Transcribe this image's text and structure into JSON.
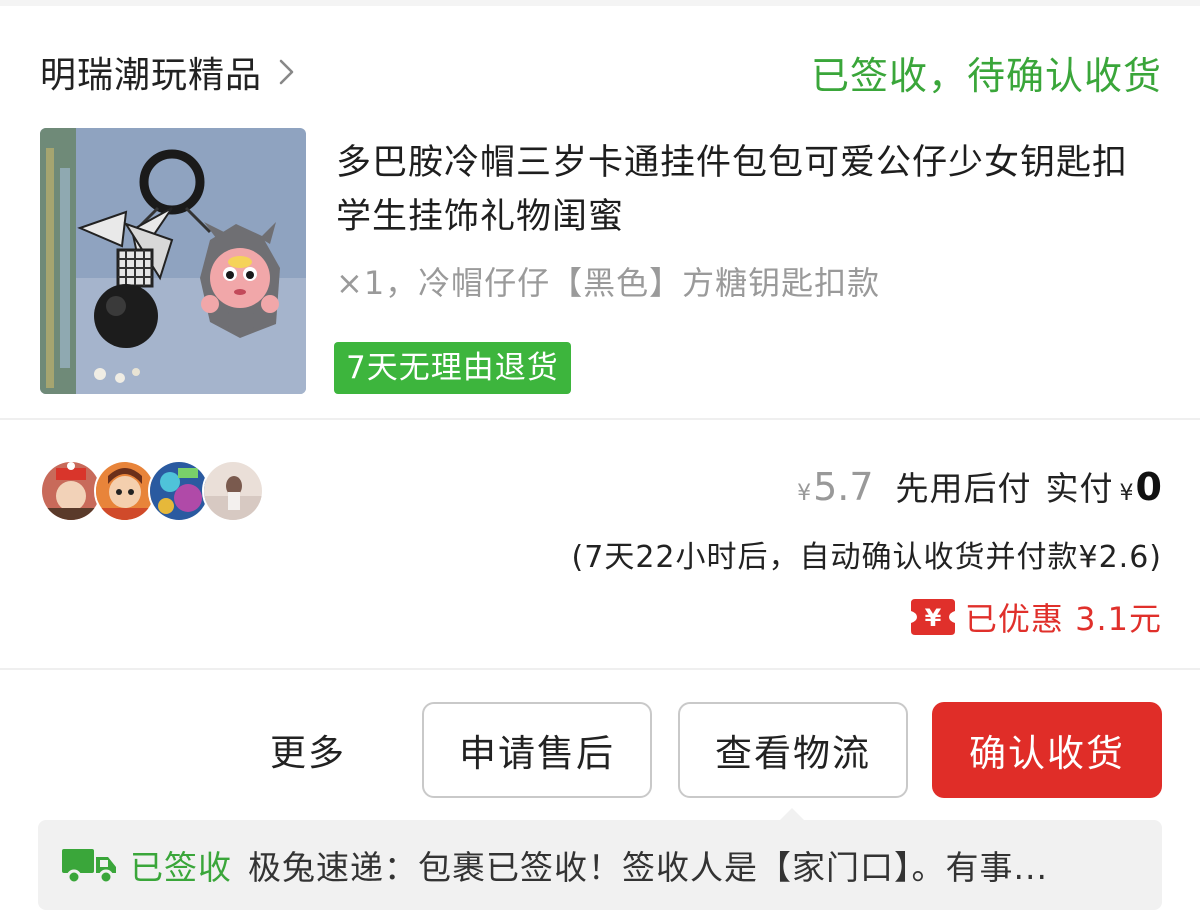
{
  "order": {
    "shop_name": "明瑞潮玩精品",
    "status": "已签收，待确认收货"
  },
  "product": {
    "title": "多巴胺冷帽三岁卡通挂件包包可爱公仔少女钥匙扣学生挂饰礼物闺蜜",
    "spec": "×1，冷帽仔仔【黑色】方糖钥匙扣款",
    "return_badge": "7天无理由退货"
  },
  "payment": {
    "currency_symbol": "¥",
    "original_price": "5.7",
    "method": "先用后付",
    "paid_label": "实付",
    "paid_amount": "0",
    "auto_confirm_note": "(7天22小时后，自动确认收货并付款¥2.6)",
    "coupon_icon_text": "¥",
    "discount_text": "已优惠 3.1元"
  },
  "actions": {
    "more": "更多",
    "after_sales": "申请售后",
    "view_logistics": "查看物流",
    "confirm_receipt": "确认收货"
  },
  "logistics": {
    "status": "已签收",
    "message": "极兔速递：包裹已签收！签收人是【家门口】。有事..."
  },
  "icons": {
    "shop_arrow": "chevron-right-icon",
    "truck": "truck-icon",
    "coupon": "coupon-icon"
  },
  "colors": {
    "status_green": "#3aa63a",
    "badge_green": "#3db53d",
    "accent_red": "#e02d28"
  }
}
